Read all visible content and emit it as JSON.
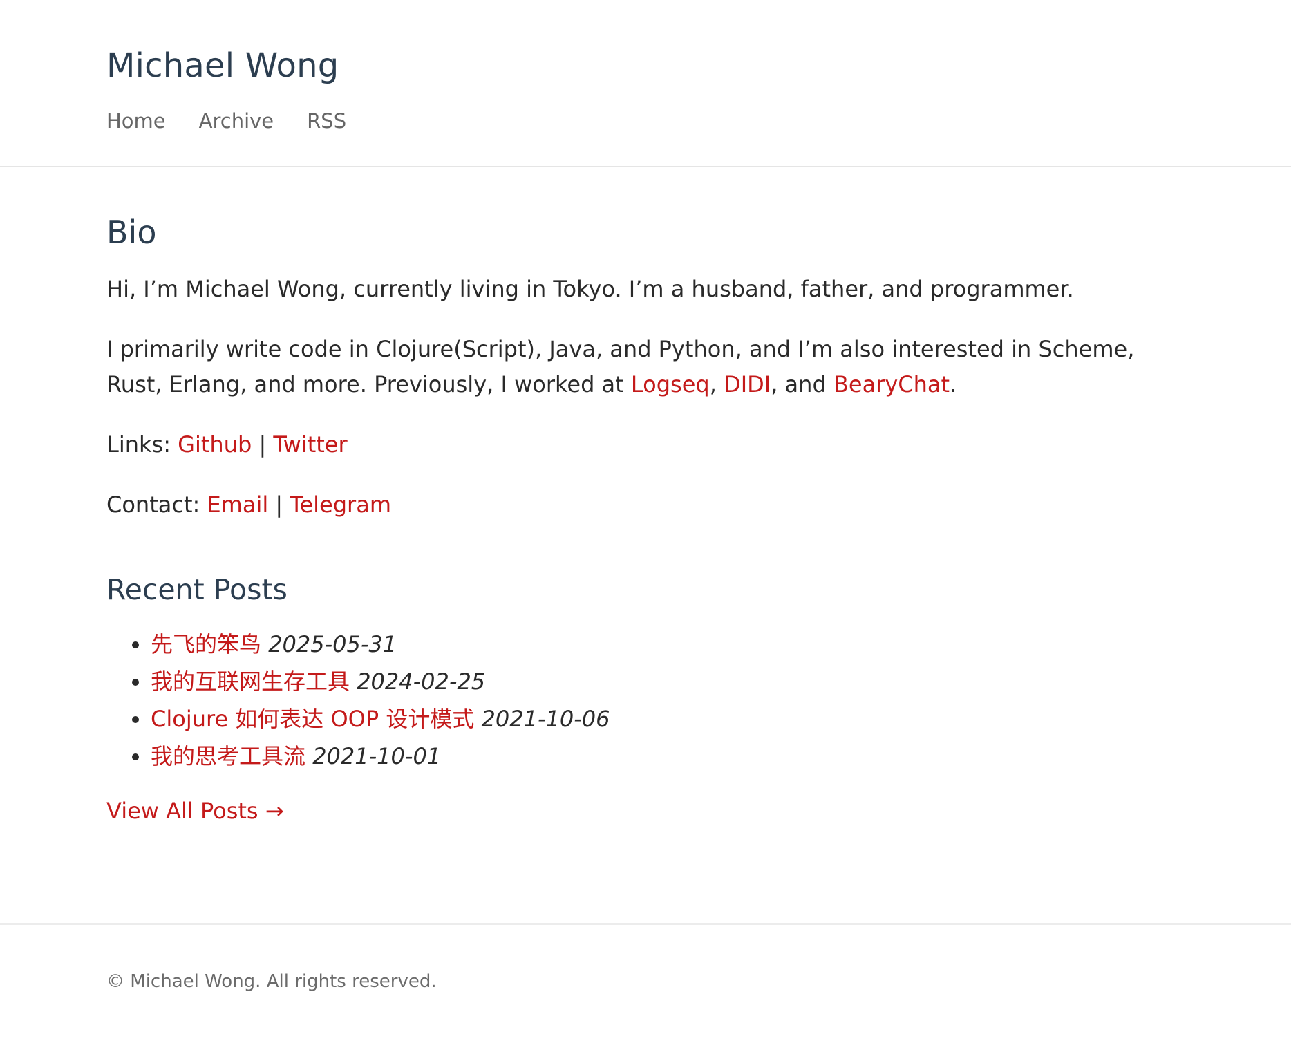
{
  "site": {
    "title": "Michael Wong",
    "nav": [
      "Home",
      "Archive",
      "RSS"
    ]
  },
  "bio": {
    "heading": "Bio",
    "intro": "Hi, I’m Michael Wong, currently living in Tokyo. I’m a husband, father, and programmer.",
    "languages_text": "I primarily write code in Clojure(Script), Java, and Python, and I’m also interested in Scheme, Rust, Erlang, and more. Previously, I worked at ",
    "companies": [
      "Logseq",
      "DIDI",
      "BearyChat"
    ],
    "sep_comma": ", ",
    "sep_and": ", and ",
    "end_period": ".",
    "links_label": "Links: ",
    "links": [
      "Github",
      "Twitter"
    ],
    "contact_label": "Contact: ",
    "contacts": [
      "Email",
      "Telegram"
    ],
    "pipe": " | "
  },
  "recent": {
    "heading": "Recent Posts",
    "posts": [
      {
        "title": "先飞的笨鸟",
        "date": "2025-05-31"
      },
      {
        "title": "我的互联网生存工具",
        "date": "2024-02-25"
      },
      {
        "title": "Clojure 如何表达 OOP 设计模式",
        "date": "2021-10-06"
      },
      {
        "title": "我的思考工具流",
        "date": "2021-10-01"
      }
    ],
    "view_all": "View All Posts →"
  },
  "footer": {
    "copyright": "© Michael Wong. All rights reserved."
  },
  "colors": {
    "accent": "#c41a1a",
    "heading": "#2c3e50",
    "muted": "#666666"
  }
}
